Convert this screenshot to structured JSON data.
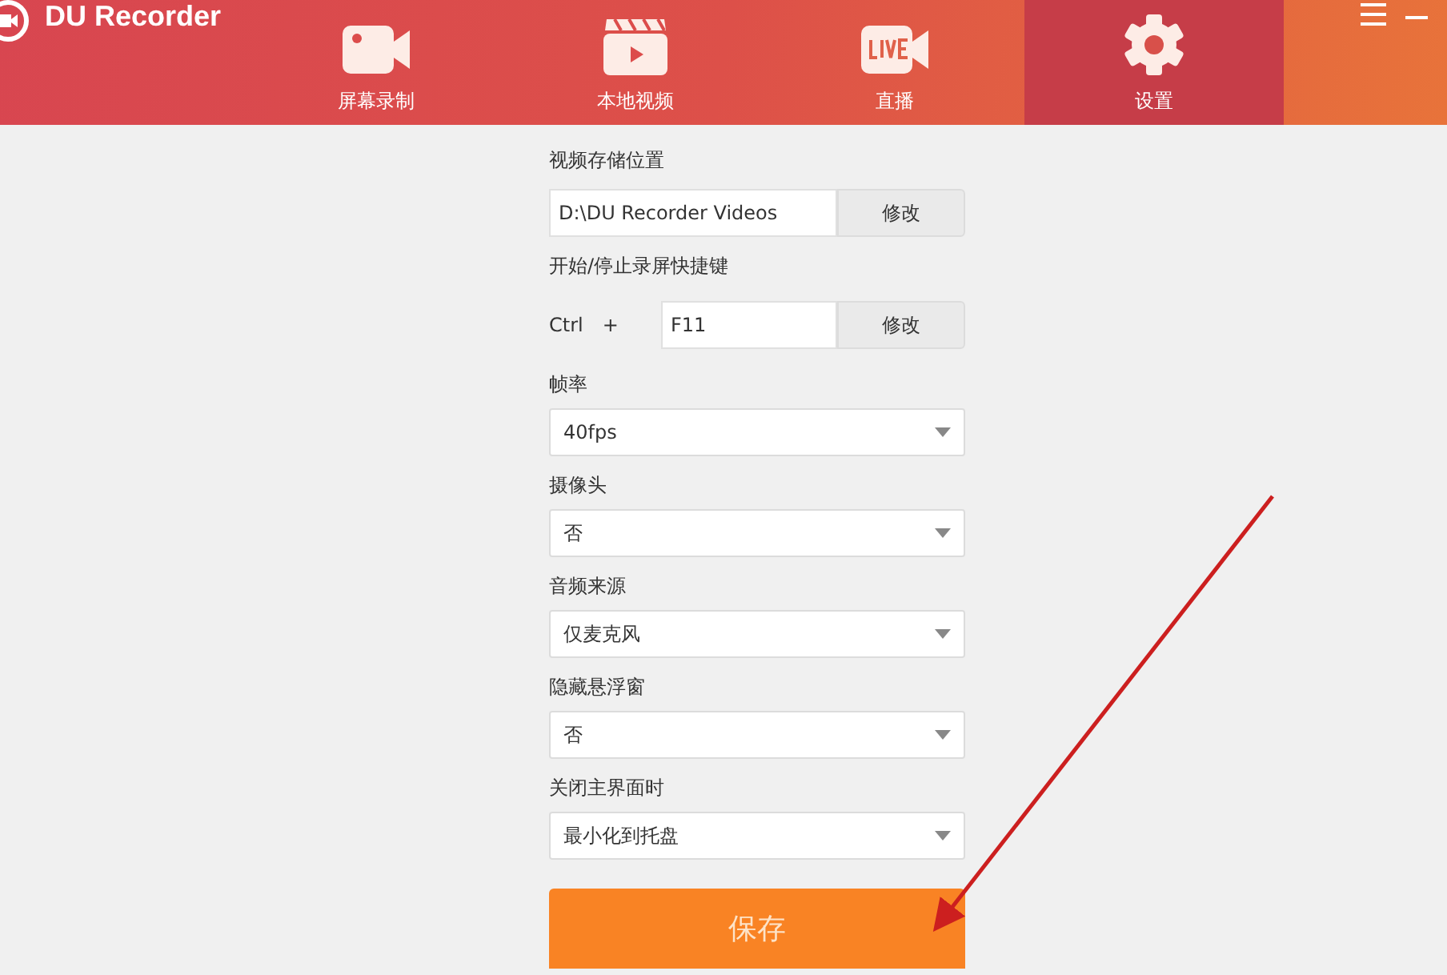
{
  "app": {
    "title": "DU Recorder"
  },
  "tabs": [
    {
      "label": "屏幕录制",
      "selected": false
    },
    {
      "label": "本地视频",
      "selected": false
    },
    {
      "label": "直播",
      "selected": false
    },
    {
      "label": "设置",
      "selected": true
    }
  ],
  "settings": [
    {
      "kind": "path",
      "label": "视频存储位置",
      "value": "D:\\DU Recorder Videos",
      "button": "修改"
    },
    {
      "kind": "hotkey",
      "label": "开始/停止录屏快捷键",
      "modifier": "Ctrl",
      "plus": "+",
      "value": "F11",
      "button": "修改"
    },
    {
      "kind": "select",
      "label": "帧率",
      "value": "40fps"
    },
    {
      "kind": "select",
      "label": "摄像头",
      "value": "否"
    },
    {
      "kind": "select",
      "label": "音频来源",
      "value": "仅麦克风"
    },
    {
      "kind": "select",
      "label": "隐藏悬浮窗",
      "value": "否"
    },
    {
      "kind": "select",
      "label": "关闭主界面时",
      "value": "最小化到托盘"
    }
  ],
  "save_button": "保存"
}
